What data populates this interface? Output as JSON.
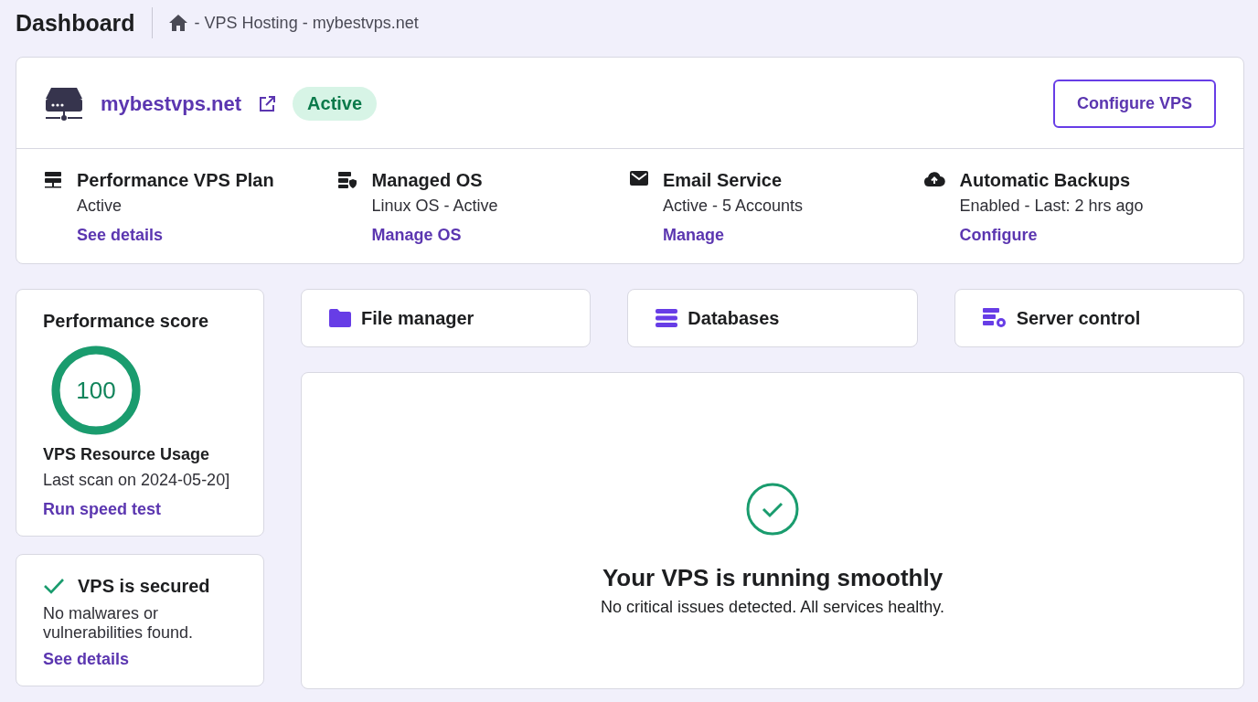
{
  "header": {
    "title": "Dashboard",
    "breadcrumb": "- VPS Hosting - mybestvps.net"
  },
  "server": {
    "domain": "mybestvps.net",
    "status": "Active",
    "button": "Configure VPS"
  },
  "services": [
    {
      "kind": "plan",
      "title": "Performance VPS Plan",
      "status": "Active",
      "link": "See details"
    },
    {
      "kind": "os",
      "title": "Managed OS",
      "status": "Linux OS - Active",
      "link": "Manage OS"
    },
    {
      "kind": "mail",
      "title": "Email Service",
      "status": "Active - 5 Accounts",
      "link": "Manage"
    },
    {
      "kind": "backup",
      "title": "Automatic Backups",
      "status": "Enabled - Last: 2 hrs ago",
      "link": "Configure"
    }
  ],
  "performance": {
    "title": "Performance score",
    "score": "100",
    "level": 1,
    "subtitle": "VPS Resource Usage",
    "scan": "Last scan on 2024-05-20]",
    "link": "Run speed test"
  },
  "security": {
    "title": "VPS is secured",
    "text": "No malwares or vulnerabilities found.",
    "link": "See details"
  },
  "shortcuts": [
    {
      "kind": "folder",
      "label": "File manager"
    },
    {
      "kind": "database",
      "label": "Databases"
    },
    {
      "kind": "server-control",
      "label": "Server control"
    }
  ],
  "health": {
    "title": "Your VPS is running smoothly",
    "text": "No critical issues detected. All services healthy."
  }
}
